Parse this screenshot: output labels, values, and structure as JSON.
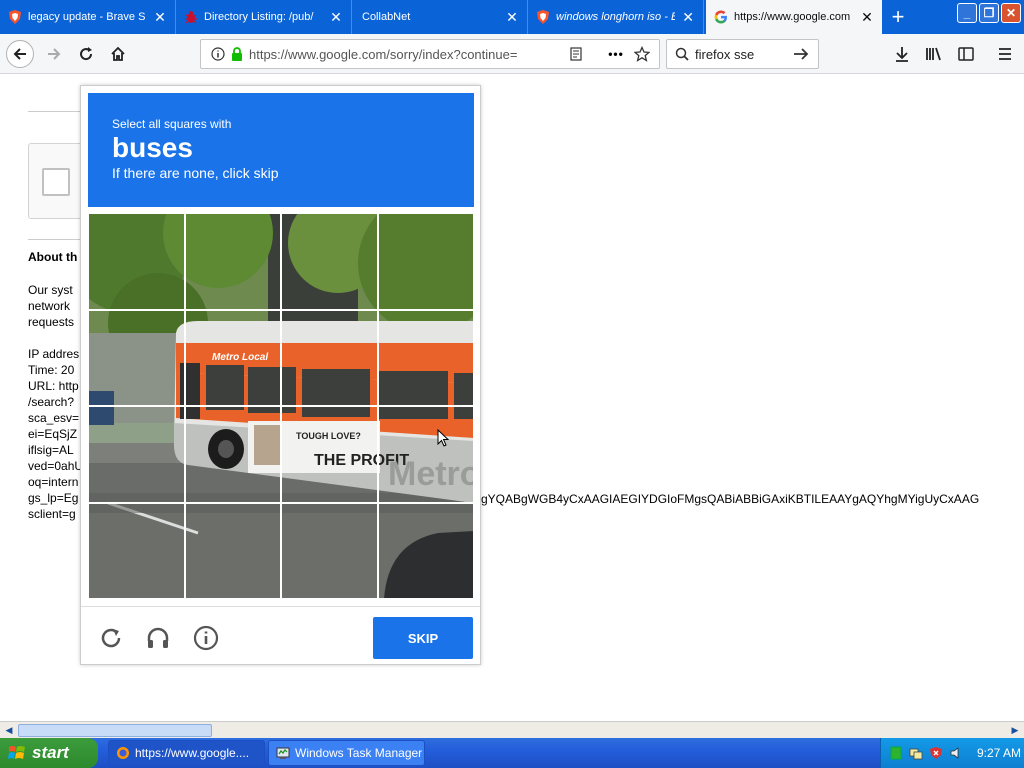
{
  "browser": {
    "tabs": [
      {
        "title": "legacy update - Brave S",
        "icon": "brave-shield-icon",
        "active": false
      },
      {
        "title": "Directory Listing: /pub/",
        "icon": "bug-icon",
        "active": false
      },
      {
        "title": "CollabNet",
        "icon": "",
        "active": false
      },
      {
        "title": "windows longhorn iso - B",
        "icon": "brave-shield-icon",
        "active": false
      },
      {
        "title": "https://www.google.com",
        "icon": "google-g-icon",
        "active": true
      }
    ],
    "url": "https://www.google.com/sorry/index?continue=",
    "search_query": "firefox sse"
  },
  "page": {
    "about_title": "About th",
    "lines": [
      "Our syst",
      "network",
      "requests",
      "",
      "IP addres",
      "Time: 20",
      "URL: http",
      "/search?",
      "sca_esv=",
      "ei=EqSjZ",
      "iflsig=AL",
      "ved=0ahU",
      "oq=intern",
      "gs_lp=Eg",
      "sclient=g"
    ],
    "gs_lp_tail": "gYQABgWGB4yCxAAGIAEGIYDGIoFMgsQABiABBiGAxiKBTILEAAYgAQYhgMYigUyCxAAG"
  },
  "captcha": {
    "instruction_small": "Select all squares with",
    "target": "buses",
    "hint": "If there are none, click skip",
    "skip_label": "SKIP",
    "bus_text": {
      "brand": "Metro Local",
      "ad_small": "TOUGH LOVE?",
      "ad_big": "THE PROFIT",
      "side": "Metro"
    }
  },
  "taskbar": {
    "start_label": "start",
    "items": [
      {
        "label": "https://www.google....",
        "icon": "firefox-icon"
      },
      {
        "label": "Windows Task Manager",
        "icon": "task-manager-icon"
      }
    ],
    "clock": "9:27 AM"
  },
  "colors": {
    "tabbar": "#0a64d8",
    "captcha_blue": "#1a73e8",
    "bus_orange": "#e8622a"
  }
}
